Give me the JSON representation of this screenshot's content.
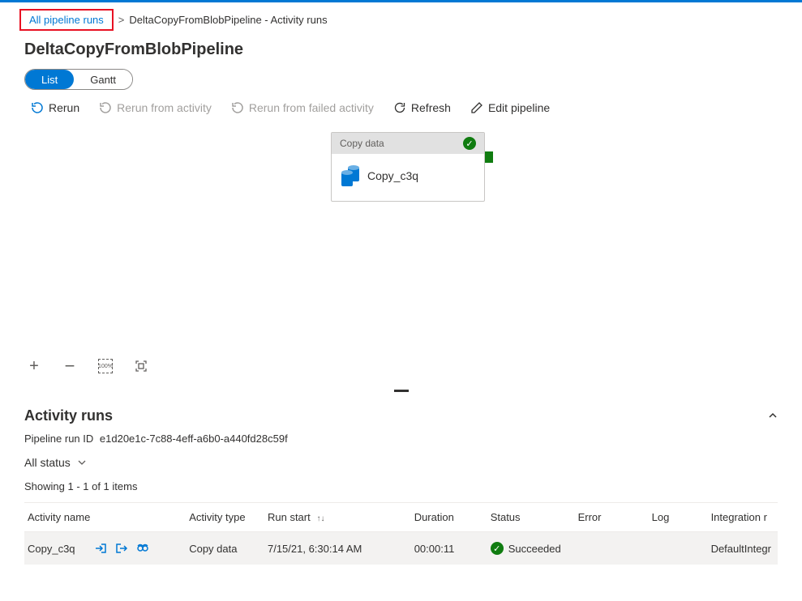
{
  "breadcrumb": {
    "link": "All pipeline runs",
    "current": "DeltaCopyFromBlobPipeline - Activity runs"
  },
  "page_title": "DeltaCopyFromBlobPipeline",
  "view_toggle": {
    "list": "List",
    "gantt": "Gantt"
  },
  "toolbar": {
    "rerun": "Rerun",
    "rerun_from_activity": "Rerun from activity",
    "rerun_from_failed": "Rerun from failed activity",
    "refresh": "Refresh",
    "edit_pipeline": "Edit pipeline"
  },
  "activity_card": {
    "header": "Copy data",
    "name": "Copy_c3q"
  },
  "zoom": {
    "percent": "100%"
  },
  "section_title": "Activity runs",
  "pipeline_run": {
    "label": "Pipeline run ID",
    "value": "e1d20e1c-7c88-4eff-a6b0-a440fd28c59f"
  },
  "filter": {
    "all_status": "All status"
  },
  "showing": "Showing 1 - 1 of 1 items",
  "table": {
    "headers": {
      "activity_name": "Activity name",
      "activity_type": "Activity type",
      "run_start": "Run start",
      "duration": "Duration",
      "status": "Status",
      "error": "Error",
      "log": "Log",
      "integration": "Integration r"
    },
    "rows": [
      {
        "activity_name": "Copy_c3q",
        "activity_type": "Copy data",
        "run_start": "7/15/21, 6:30:14 AM",
        "duration": "00:00:11",
        "status": "Succeeded",
        "error": "",
        "log": "",
        "integration": "DefaultIntegr"
      }
    ]
  }
}
